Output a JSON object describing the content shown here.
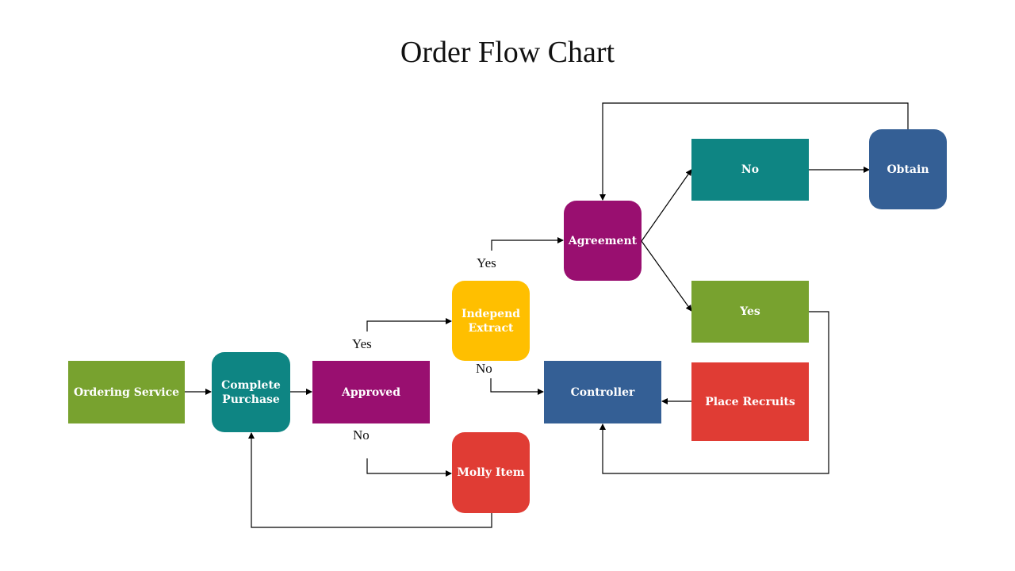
{
  "title": "Order Flow Chart",
  "colors": {
    "green": "#78a22f",
    "teal": "#0e8583",
    "purple": "#990f70",
    "yellow": "#ffbf00",
    "red": "#e03c34",
    "blue": "#345f95",
    "line": "#000000"
  },
  "nodes": {
    "ordering_service": "Ordering Service",
    "complete_purchase": "Complete Purchase",
    "approved": "Approved",
    "independ_extract": "Independ Extract",
    "molly_item": "Molly Item",
    "agreement": "Agreement",
    "controller": "Controller",
    "no_box": "No",
    "yes_box": "Yes",
    "obtain": "Obtain",
    "place_recruits": "Place Recruits"
  },
  "labels": {
    "approved_yes": "Yes",
    "approved_no": "No",
    "extract_yes": "Yes",
    "extract_no": "No"
  }
}
